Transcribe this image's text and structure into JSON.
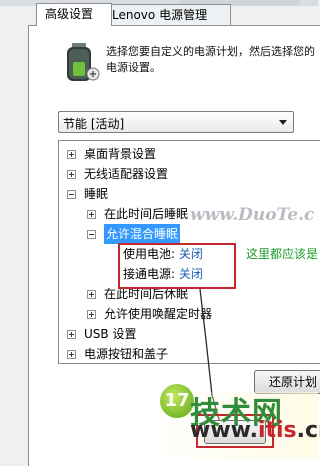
{
  "tabs": [
    {
      "label": "高级设置"
    },
    {
      "label": "Lenovo 电源管理"
    }
  ],
  "description": "选择您要自定义的电源计划，然后选择您的电源设置。",
  "plan_select": {
    "value": "节能 [活动]"
  },
  "tree": {
    "items": [
      {
        "label": "桌面背景设置"
      },
      {
        "label": "无线适配器设置"
      },
      {
        "label": "睡眠"
      },
      {
        "label": "在此时间后睡眠"
      },
      {
        "label": "允许混合睡眠"
      },
      {
        "label": "使用电池:",
        "value": "关闭"
      },
      {
        "label": "接通电源:",
        "value": "关闭"
      },
      {
        "label": "在此时间后休眠"
      },
      {
        "label": "允许使用唤醒定时器"
      },
      {
        "label": "USB 设置"
      },
      {
        "label": "电源按钮和盖子"
      }
    ]
  },
  "annotation": "这里都应该是",
  "watermark": "www.DuoTe.c",
  "restore_button": {
    "label": "还原计划"
  },
  "logo": {
    "number": "17",
    "cn": "技术网",
    "url_a": "www.",
    "url_b": "itis",
    "url_c": ".cn"
  },
  "colors": {
    "highlight": "#3399ff",
    "link": "#1a5fb4",
    "annotation": "#1b9a2c",
    "callout": "#c4272d"
  }
}
